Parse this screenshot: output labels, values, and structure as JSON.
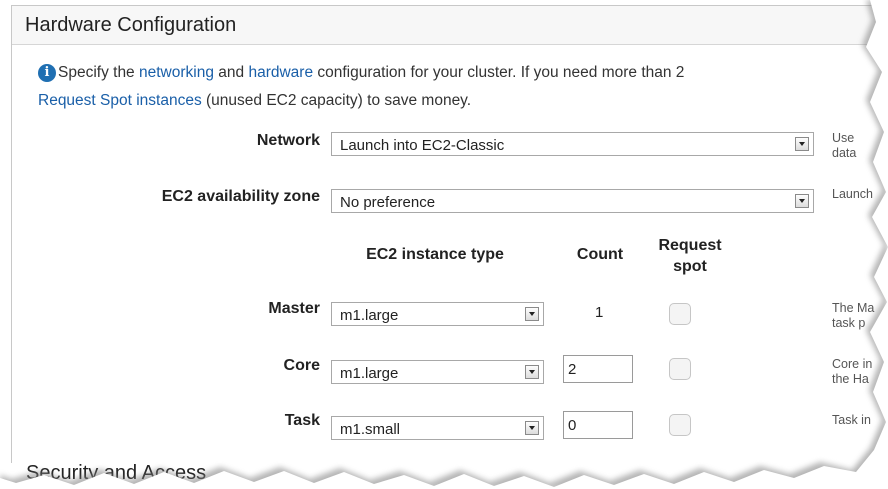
{
  "section": {
    "title": "Hardware Configuration"
  },
  "info": {
    "icon": "info-icon",
    "line1_prefix": "Specify the ",
    "link_networking": "networking",
    "line1_mid": " and ",
    "link_hardware": "hardware",
    "line1_suffix": " configuration for your cluster. If you need more than 2",
    "link_spot": "Request Spot instances",
    "line2_suffix": " (unused EC2 capacity) to save money."
  },
  "network": {
    "label": "Network",
    "value": "Launch into EC2-Classic",
    "hint_line1": "Use",
    "hint_line2": "data"
  },
  "availability_zone": {
    "label": "EC2 availability zone",
    "value": "No preference",
    "hint": "Launch"
  },
  "table": {
    "col_instance_type": "EC2 instance type",
    "col_count": "Count",
    "col_request_line1": "Request",
    "col_request_line2": "spot",
    "rows": [
      {
        "label": "Master",
        "type": "m1.large",
        "count": "1",
        "hint_line1": "The Ma",
        "hint_line2": "task p"
      },
      {
        "label": "Core",
        "type": "m1.large",
        "count": "2",
        "hint_line1": "Core in",
        "hint_line2": "the Ha"
      },
      {
        "label": "Task",
        "type": "m1.small",
        "count": "0",
        "hint_line1": "Task in",
        "hint_line2": ""
      }
    ]
  },
  "next_section": {
    "title": "Security and Access"
  }
}
